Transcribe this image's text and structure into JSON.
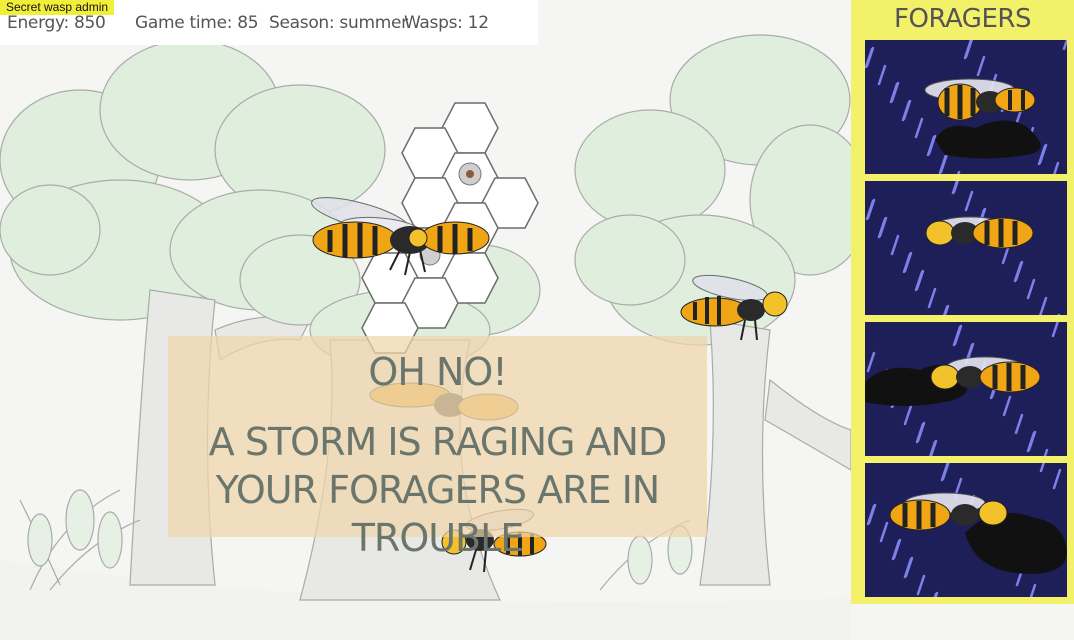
{
  "admin_button": {
    "label": "Secret wasp admin"
  },
  "status": {
    "energy": "Energy: 850",
    "game_time": "Game time: 85",
    "season": "Season: summer",
    "wasps": "Wasps: 12"
  },
  "sidebar": {
    "title": "FORAGERS",
    "foragers": [
      {
        "icon": "wasp-in-storm-icon"
      },
      {
        "icon": "wasp-in-storm-icon"
      },
      {
        "icon": "wasp-in-storm-icon"
      },
      {
        "icon": "wasp-in-storm-icon"
      }
    ]
  },
  "alert": {
    "title": "OH NO!",
    "message": "A STORM IS RAGING AND YOUR FORAGERS ARE IN TROUBLE"
  },
  "colors": {
    "sidebar_bg": "#f3f06a",
    "storm_bg": "#1e1f58",
    "rain": "#7c80e8",
    "alert_bg": "#f0d6aa",
    "tree_leaves": "#dfeedd",
    "wasp_yellow": "#f0a515"
  }
}
